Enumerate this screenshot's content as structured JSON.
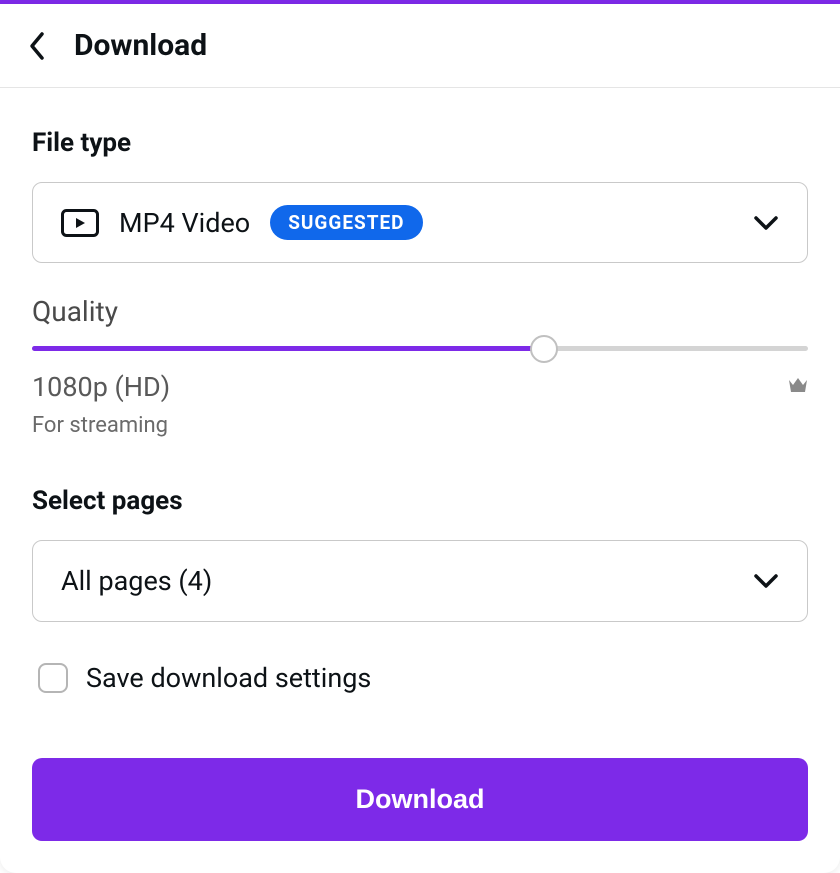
{
  "header": {
    "title": "Download"
  },
  "file_type": {
    "label": "File type",
    "selected": "MP4 Video",
    "badge": "SUGGESTED"
  },
  "quality": {
    "label": "Quality",
    "value": "1080p (HD)",
    "description": "For streaming",
    "slider_percent": 66
  },
  "pages": {
    "label": "Select pages",
    "selected": "All pages (4)"
  },
  "save_settings": {
    "label": "Save download settings",
    "checked": false
  },
  "download_button": {
    "label": "Download"
  },
  "colors": {
    "accent": "#7d2ae8",
    "badge_bg": "#1068eb"
  }
}
